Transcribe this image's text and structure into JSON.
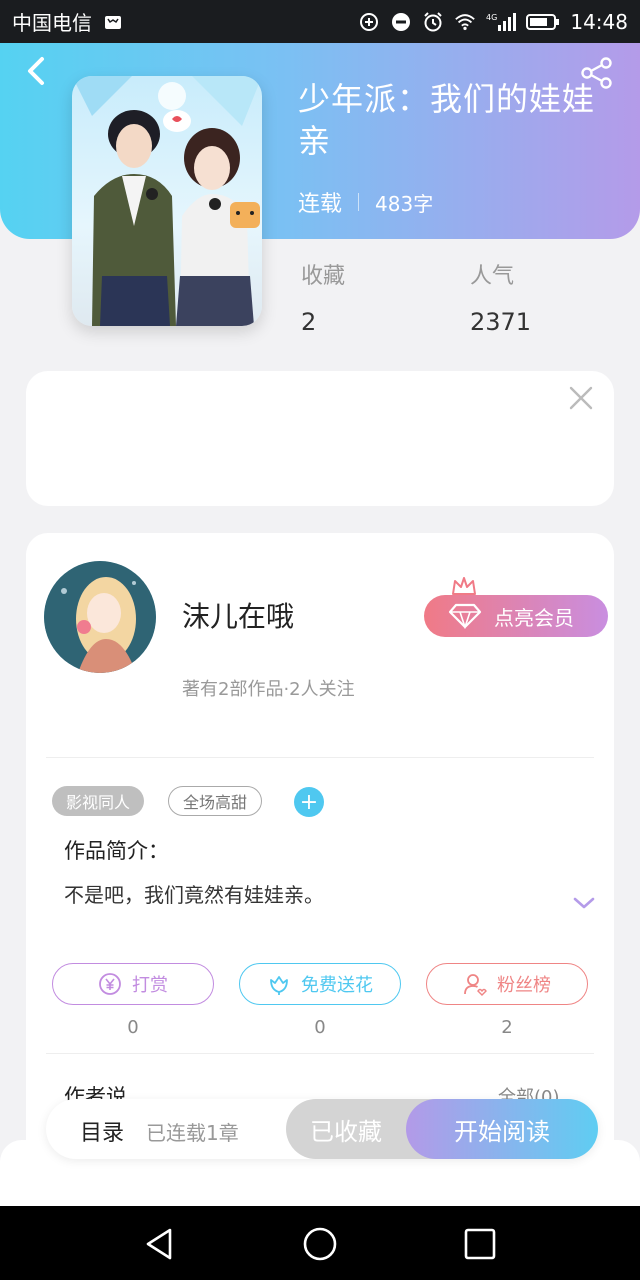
{
  "status_bar": {
    "carrier": "中国电信",
    "network": "4G",
    "time": "14:48"
  },
  "header": {
    "back_icon": "chevron-left-icon",
    "share_icon": "share-icon",
    "title": "少年派：我们的娃娃亲",
    "status": "连载",
    "word_count": "483字",
    "gradient": [
      "#55d2f2",
      "#b49be9"
    ]
  },
  "stats": {
    "favorites_label": "收藏",
    "favorites_value": "2",
    "popularity_label": "人气",
    "popularity_value": "2371"
  },
  "author": {
    "name": "沫儿在哦",
    "info": "著有2部作品·2人关注",
    "vip_button": "点亮会员"
  },
  "tags": {
    "items": [
      "影视同人",
      "全场高甜"
    ],
    "add_icon": "+"
  },
  "intro": {
    "title": "作品简介：",
    "text": "不是吧，我们竟然有娃娃亲。"
  },
  "actions": [
    {
      "label": "打赏",
      "count": "0",
      "color": "#c28ce0",
      "icon": "yen-icon"
    },
    {
      "label": "免费送花",
      "count": "0",
      "color": "#4fc8f0",
      "icon": "flower-icon"
    },
    {
      "label": "粉丝榜",
      "count": "2",
      "color": "#ef8585",
      "icon": "fan-user-icon"
    }
  ],
  "author_says": {
    "title": "作者说",
    "all_link": "全部(0)"
  },
  "bottom_bar": {
    "toc_label": "目录",
    "toc_sub": "已连载1章",
    "collected_label": "已收藏",
    "read_label": "开始阅读"
  }
}
